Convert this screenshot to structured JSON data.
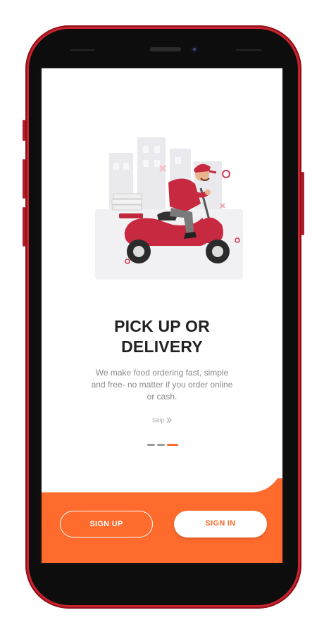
{
  "onboarding": {
    "title_line1": "PICK UP OR",
    "title_line2": "DELIVERY",
    "description": "We make food ordering fast, simple and free- no matter if you order online or cash.",
    "skip_label": "Skip",
    "skip_icon": "chevron-right-icon",
    "page_indicator": {
      "total": 3,
      "active": 3
    }
  },
  "actions": {
    "sign_up_label": "SIGN UP",
    "sign_in_label": "SIGN IN"
  },
  "colors": {
    "accent": "#ff6b2d",
    "phone_frame": "#c8232f",
    "title": "#222222",
    "description": "#8a8a8a"
  }
}
